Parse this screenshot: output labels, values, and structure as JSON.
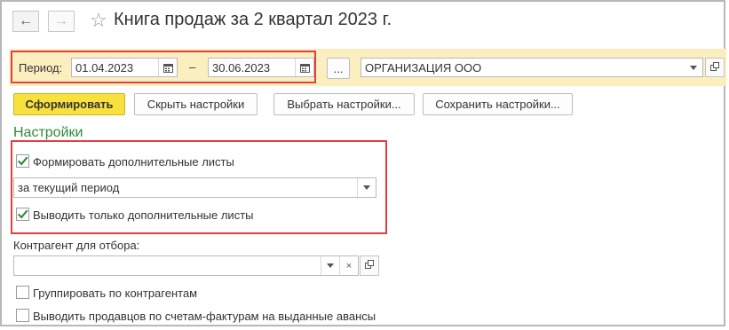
{
  "window": {
    "title": "Книга продаж за 2 квартал 2023 г.",
    "back_icon": "arrow-left-icon",
    "forward_icon": "arrow-right-icon",
    "favorite_icon": "star-icon"
  },
  "toolbar": {
    "period_label": "Период:",
    "date_from": "01.04.2023",
    "date_separator": "–",
    "date_to": "30.06.2023",
    "ellipsis_label": "...",
    "organization": "ОРГАНИЗАЦИЯ ООО"
  },
  "actions": {
    "generate": "Сформировать",
    "hide_settings": "Скрыть настройки",
    "choose_settings": "Выбрать настройки...",
    "save_settings": "Сохранить настройки..."
  },
  "settings": {
    "title": "Настройки",
    "form_additional_sheets": {
      "label": "Формировать дополнительные листы",
      "checked": true
    },
    "period_select": "за текущий период",
    "only_additional_sheets": {
      "label": "Выводить только дополнительные листы",
      "checked": true
    },
    "counterparty_label": "Контрагент для отбора:",
    "counterparty_value": "",
    "group_by_counterparty": {
      "label": "Группировать по контрагентам",
      "checked": false
    },
    "sellers_by_invoices": {
      "label": "Выводить продавцов по счетам-фактурам на выданные авансы",
      "checked": false
    }
  },
  "colors": {
    "accent_yellow": "#f8e13d",
    "toolbar_bg": "#fbefc0",
    "highlight_red": "#e04040",
    "section_green": "#2e8b3a",
    "check_green": "#2e8b3a"
  }
}
